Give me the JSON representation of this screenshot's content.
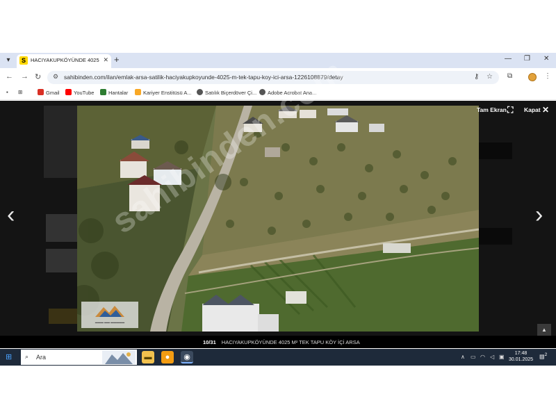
{
  "browser": {
    "tab_title": "HACIYAKUPKÖYÜNDE 4025 M² TI",
    "tab_favicon": "S",
    "new_tab": "+",
    "url": "sahibinden.com/ilan/emlak-arsa-satilik-haciyakupkoyunde-4025-m-tek-tapu-koy-ici-arsa-1226108879/detay"
  },
  "bookmarks": [
    {
      "label": "Gmail",
      "icon": "gmail-icon",
      "color": "#d93025"
    },
    {
      "label": "YouTube",
      "icon": "youtube-icon",
      "color": "#ff0000"
    },
    {
      "label": "Hantalar",
      "icon": "hantalar-icon",
      "color": "#2e7d32"
    },
    {
      "label": "Kariyer Enstitüsü A...",
      "icon": "kariyer-icon",
      "color": "#f9a825"
    },
    {
      "label": "Satılık Biçerdöver Çi...",
      "icon": "globe-icon",
      "color": "#555555"
    },
    {
      "label": "Adobe Acrobat Ana...",
      "icon": "globe-icon",
      "color": "#555555"
    }
  ],
  "lightbox": {
    "fullscreen_label": "Tam Ekran",
    "close_label": "Kapat",
    "counter": "10/31",
    "caption": "HACIYAKUPKÖYÜNDE 4025 M² TEK TAPU KÖY İÇİ ARSA",
    "watermark": "sahibinden.com",
    "prev_arrow": "‹",
    "next_arrow": "›"
  },
  "taskbar": {
    "search_placeholder": "Ara",
    "time": "17:48",
    "date": "30.01.2025",
    "notifications": "2"
  },
  "colors": {
    "tabbar": "#dbe3f3",
    "overlay": "#141414",
    "taskbar": "#1e2a3a",
    "favicon": "#ffd800"
  }
}
